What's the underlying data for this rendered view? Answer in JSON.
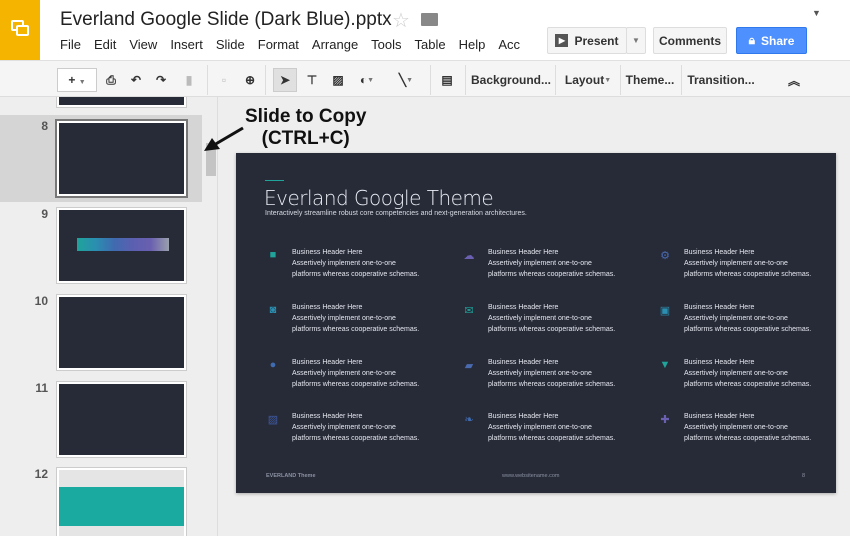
{
  "app": {
    "title": "Everland Google Slide (Dark Blue).pptx",
    "logo_icon": "slides-logo-icon",
    "brand_color": "#f4b400"
  },
  "menu": [
    "File",
    "Edit",
    "View",
    "Insert",
    "Slide",
    "Format",
    "Arrange",
    "Tools",
    "Table",
    "Help",
    "Acc"
  ],
  "actions": {
    "present": "Present",
    "comments": "Comments",
    "share": "Share",
    "share_color": "#4d90fe"
  },
  "toolbar": {
    "background": "Background...",
    "layout": "Layout",
    "theme": "Theme...",
    "transition": "Transition..."
  },
  "filmstrip": {
    "slides": [
      {
        "number": "8",
        "selected": true
      },
      {
        "number": "9"
      },
      {
        "number": "10"
      },
      {
        "number": "11"
      },
      {
        "number": "12"
      }
    ]
  },
  "annotation": {
    "line1": "Slide to Copy",
    "line2": "(CTRL+C)"
  },
  "slide": {
    "title": "Everland Google Theme",
    "subtitle": "Interactively streamline robust core competencies and next-generation architectures.",
    "items": [
      {
        "icon": "briefcase-icon",
        "glyph": "■",
        "color": "#1fa39a",
        "header": "Business Header Here",
        "l1": "Assertively implement one-to-one",
        "l2": "platforms whereas cooperative schemas."
      },
      {
        "icon": "cloud-download-icon",
        "glyph": "☁",
        "color": "#6a5fb0",
        "header": "Business Header Here",
        "l1": "Assertively implement one-to-one",
        "l2": "platforms whereas cooperative schemas."
      },
      {
        "icon": "gears-icon",
        "glyph": "⚙",
        "color": "#4a6ab0",
        "header": "Business Header Here",
        "l1": "Assertively implement one-to-one",
        "l2": "platforms whereas cooperative schemas."
      },
      {
        "icon": "camera-icon",
        "glyph": "◙",
        "color": "#2a8fb0",
        "header": "Business Header Here",
        "l1": "Assertively implement one-to-one",
        "l2": "platforms whereas cooperative schemas."
      },
      {
        "icon": "envelope-icon",
        "glyph": "✉",
        "color": "#1fa39a",
        "header": "Business Header Here",
        "l1": "Assertively implement one-to-one",
        "l2": "platforms whereas cooperative schemas."
      },
      {
        "icon": "gift-icon",
        "glyph": "▣",
        "color": "#2a8fb0",
        "header": "Business Header Here",
        "l1": "Assertively implement one-to-one",
        "l2": "platforms whereas cooperative schemas."
      },
      {
        "icon": "users-icon",
        "glyph": "●",
        "color": "#3f6bb0",
        "header": "Business Header Here",
        "l1": "Assertively implement one-to-one",
        "l2": "platforms whereas cooperative schemas."
      },
      {
        "icon": "folder-open-icon",
        "glyph": "▰",
        "color": "#4a6ab0",
        "header": "Business Header Here",
        "l1": "Assertively implement one-to-one",
        "l2": "platforms whereas cooperative schemas."
      },
      {
        "icon": "cart-icon",
        "glyph": "▼",
        "color": "#1fa39a",
        "header": "Business Header Here",
        "l1": "Assertively implement one-to-one",
        "l2": "platforms whereas cooperative schemas."
      },
      {
        "icon": "image-icon",
        "glyph": "▨",
        "color": "#3f5aa0",
        "header": "Business Header Here",
        "l1": "Assertively implement one-to-one",
        "l2": "platforms whereas cooperative schemas."
      },
      {
        "icon": "leaf-icon",
        "glyph": "❧",
        "color": "#3f6bb0",
        "header": "Business Header Here",
        "l1": "Assertively implement one-to-one",
        "l2": "platforms whereas cooperative schemas."
      },
      {
        "icon": "puzzle-icon",
        "glyph": "✚",
        "color": "#6a5fb0",
        "header": "Business Header Here",
        "l1": "Assertively implement one-to-one",
        "l2": "platforms whereas cooperative schemas."
      }
    ],
    "footer": {
      "left": "EVERLAND Theme",
      "center": "www.websitename.com",
      "page": "8"
    }
  }
}
